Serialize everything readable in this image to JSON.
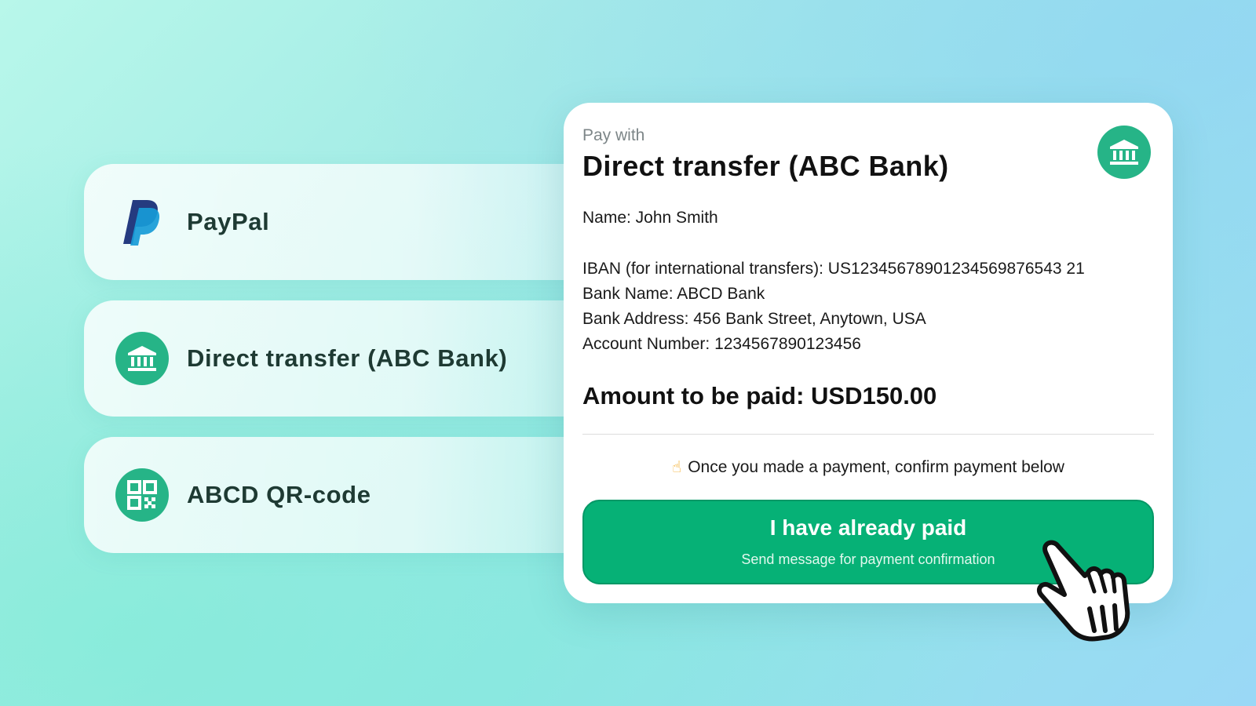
{
  "methods": [
    {
      "label": "PayPal",
      "icon": "paypal-logo-icon"
    },
    {
      "label": "Direct transfer (ABC Bank)",
      "icon": "bank-icon"
    },
    {
      "label": "ABCD QR-code",
      "icon": "qr-code-icon"
    }
  ],
  "card": {
    "pay_with": "Pay with",
    "title": "Direct transfer (ABC Bank)",
    "icon": "bank-icon",
    "name": "Name: John Smith",
    "iban": "IBAN (for international transfers): US12345678901234569876543 21",
    "bank_name": "Bank Name: ABCD Bank",
    "bank_address": "Bank Address: 456 Bank Street, Anytown, USA",
    "account_number": "Account Number: 1234567890123456",
    "amount": "Amount to be paid: USD150.00",
    "hint_icon": "pointing-finger-icon",
    "hint": "Once you made a payment, confirm payment below"
  },
  "button": {
    "label": "I have already paid",
    "sublabel": "Send message for payment confirmation"
  },
  "colors": {
    "accent": "#06b176",
    "icon_bg": "#26b487",
    "paypal_dark": "#253b80",
    "paypal_light": "#179bd7"
  }
}
